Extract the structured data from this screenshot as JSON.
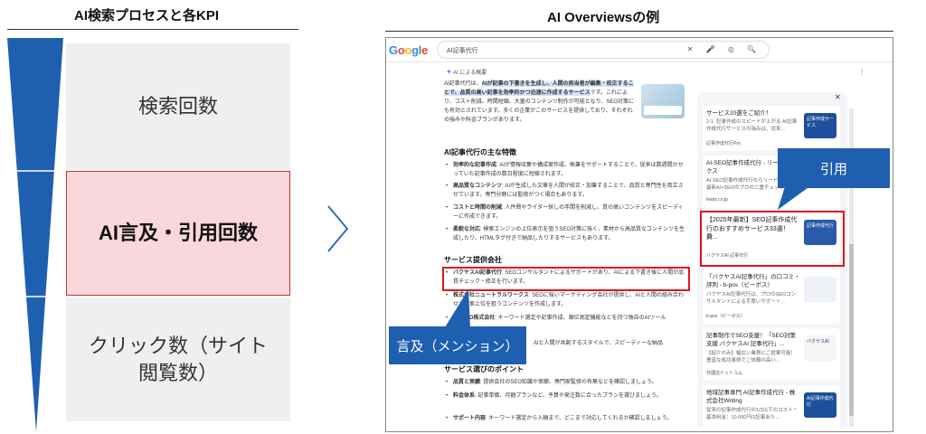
{
  "left_title": "AI検索プロセスと各KPI",
  "right_title": "AI Overviewsの例",
  "funnel": {
    "stage1": "検索回数",
    "stage2": "AI言及・引用回数",
    "stage3_line1": "クリック数（サイト",
    "stage3_line2": "閲覧数）"
  },
  "browser": {
    "logo": "Google",
    "query": "AI記事代行",
    "search_icons": "✕ 🎤 ◎ 🔍",
    "ai_label": "AI による概要",
    "intro_a": "AI記事代行は、",
    "intro_b": "AIが記事の下書きを生成し、人間の担当者が編集・校正することで、品質の高い記事を効率的かつ迅速に作成するサービス",
    "intro_c": "です。これにより、コスト削減、時間短縮、大量のコンテンツ制作が可能となり、SEO対策にも有効とされています。多くの企業がこのサービスを提供しており、それぞれの強みや料金プランがあります。",
    "sec1": "AI記事代行の主な特徴",
    "f1_b": "効率的な記事作成",
    "f1_t": ": AIが情報収集や構成案作成、執筆をサポートすることで、従来は数週間かかっていた記事作成の数日程度に短縮されます。",
    "f2_b": "高品質なコンテンツ",
    "f2_t": ": AIが生成した文章を人間が校正・加筆することで、品質と専門性を両立させています。専門分野には監修がつく場合もあります。",
    "f3_b": "コストと時間の削減",
    "f3_t": ": 人件費やライター探しの手間を削減し、質の高いコンテンツをスピーディーに作成できます。",
    "f4_b": "柔軟な対応",
    "f4_t": ": 検索エンジンの上位表示を狙うSEO対策に強く、素材から高品質なコンテンツを生成したり、HTMLタグ付きで納品したりするサービスもあります。",
    "sec2": "サービス提供会社",
    "s1_b": "バクヤスAI記事代行",
    "s1_t": ": SEOコンサルタントによるサポートがあり、AIによる下書き後に人間が品質チェック・修正を行います。",
    "s2_b": "株式会社ニュートラルワークス",
    "s2_t": ": SEOに強いマーケティング会社が提供し、AIと人間の組み合わせで検索上位を狙うコンテンツを作成します。",
    "s3_b": "CROCO株式会社",
    "s3_t": ": キーワード選定や記事作成、順位測定機能などを持つ独自のAIツール",
    "s4_t": "AIと人間が共創するスタイルで、スピーディーな納品",
    "sec3": "サービス選びのポイント",
    "p1_b": "品質と実績",
    "p1_t": ": 提供会社のSEO知識や実績、専門家監修の有無などを確認しましょう。",
    "p2_b": "料金体系",
    "p2_t": ": 記事単価、月額プランなど、予算や発注数に合ったプランを選びましょう。",
    "p3_b": "サポート内容",
    "p3_t": ": キーワード選定から入稿まで、どこまで対応してくれるか確認しましょう。",
    "cards": [
      {
        "title": "サービス20選をご紹介！",
        "sub": "2-1. 記事作成のスピードが上がる AI記事作成代行サービスの強みは、従来...",
        "src": "記事作成代行Pro",
        "thumb": "記事作成サービス"
      },
      {
        "title": "AI-SEO記事作成代行 - リードエックス",
        "sub": "AI-SEO記事作成代行ならリードエックス 最新AI×SEOのプロの二重チェック...",
        "src": "leadx.co.jp",
        "thumb": ""
      },
      {
        "title": "【2025年最新】SEO記事作成代行のおすすめサービス33選！費...",
        "sub": "",
        "src": "バクヤスAI 記事代行",
        "thumb": "記事作成代行"
      },
      {
        "title": "「バクヤスAI記事代行」の口コミ・評判 - b-pos（ビーポス）",
        "sub": "バクヤスAI記事代行は、プロのSEOコンサルタントによる手厚いサポート...",
        "src": "b-pos（ビーポス）",
        "thumb": ""
      },
      {
        "title": "記事制作でSEO支援！「SEO対策支援 バクヤスAI 記事代行」...",
        "sub": "【紹介のみ】幅広い業界にご提案可能！ 豊富な成功事例でご依頼の高い...",
        "src": "代理店ドットコム",
        "thumb": "バクヤスAI"
      },
      {
        "title": "地域記事専門 AI記事作成代行 - 株式会社Writing",
        "sub": "従来の記事作成代行の1/3以下のコスト * 基本料金：10,000円/1記事あた...",
        "src": "",
        "thumb": "AI記事作成代行"
      }
    ]
  },
  "callouts": {
    "cite": "引用",
    "mention": "言及（メンション）"
  },
  "colors": {
    "funnel_blue": "#1f5fb0",
    "highlight_pink": "#f9d7dc",
    "frame_red": "#e0151b",
    "callout_blue": "#1f5fb0"
  }
}
